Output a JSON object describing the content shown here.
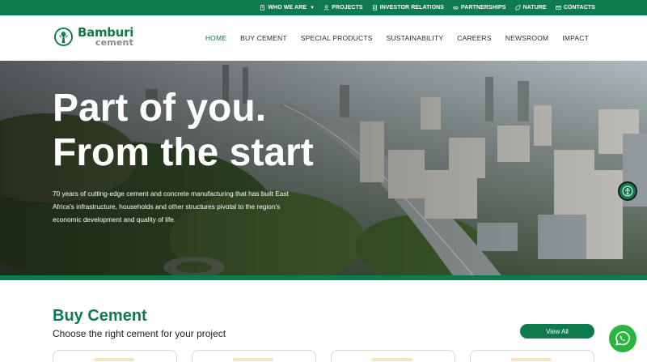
{
  "topbar": {
    "items": [
      {
        "label": "WHO WE ARE",
        "icon": "building-icon",
        "has_dropdown": true
      },
      {
        "label": "PROJECTS",
        "icon": "person-icon"
      },
      {
        "label": "INVESTOR RELATIONS",
        "icon": "document-icon"
      },
      {
        "label": "PARTNERSHIPS",
        "icon": "handshake-icon"
      },
      {
        "label": "NATURE",
        "icon": "leaf-icon"
      },
      {
        "label": "CONTACTS",
        "icon": "mail-icon"
      }
    ]
  },
  "header": {
    "logo_brand": "Bamburi",
    "logo_sub": "cement",
    "nav": [
      {
        "label": "HOME",
        "active": true
      },
      {
        "label": "BUY CEMENT"
      },
      {
        "label": "SPECIAL PRODUCTS"
      },
      {
        "label": "SUSTAINABILITY"
      },
      {
        "label": "CAREERS"
      },
      {
        "label": "NEWSROOM"
      },
      {
        "label": "IMPACT"
      }
    ]
  },
  "hero": {
    "title_line1": "Part of you.",
    "title_line2": "From the start",
    "description": "70 years of  cutting-edge cement and concrete manufacturing that has built East Africa's infrastructure, households and other structures pivotal to the region's economic development and quality of life."
  },
  "section": {
    "title": "Buy Cement",
    "subtitle": "Choose the right cement for your project",
    "view_all_label": "View All"
  },
  "colors": {
    "brand_green": "#0e7a4e",
    "whatsapp_green": "#2ab540"
  }
}
